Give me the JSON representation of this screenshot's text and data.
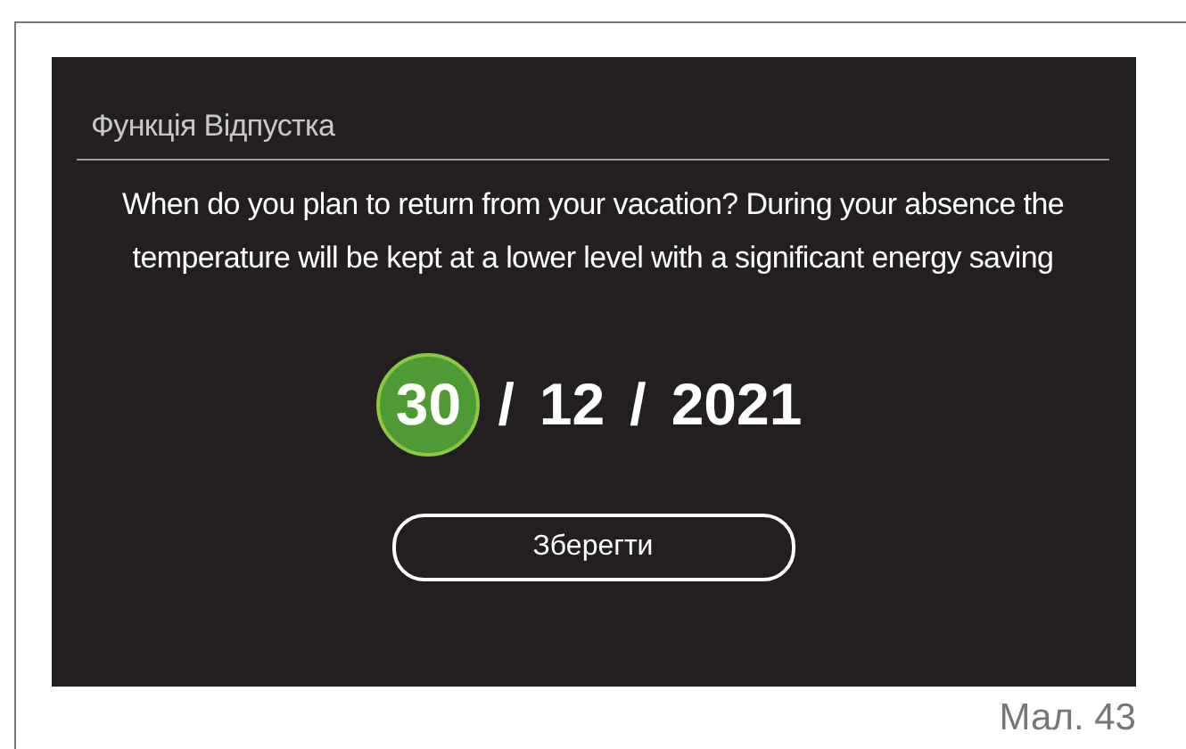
{
  "screen": {
    "title": "Функція Відпустка",
    "message": "When do you plan to return from your vacation? During your absence the temperature will be kept at a lower level with a significant energy saving",
    "date": {
      "fields": [
        {
          "text": "30",
          "selected": true
        },
        {
          "text": "12",
          "selected": false
        },
        {
          "text": "2021",
          "selected": false
        }
      ],
      "separators": [
        "/",
        "/"
      ]
    },
    "save_button": "Зберегти"
  },
  "caption": "Мал. 43"
}
